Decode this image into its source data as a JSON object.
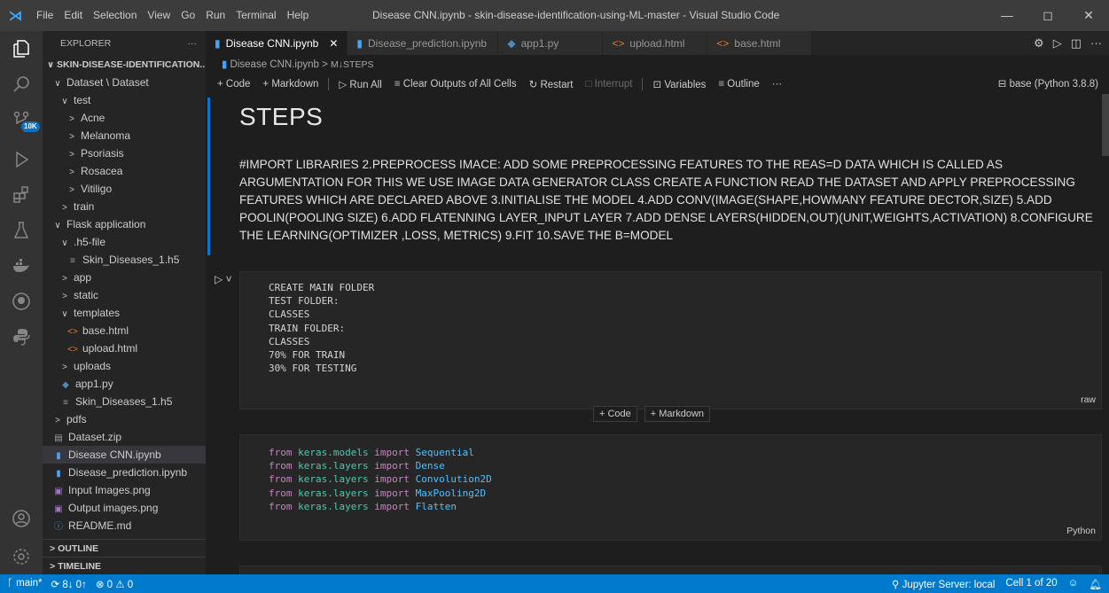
{
  "window": {
    "title": "Disease CNN.ipynb - skin-disease-identification-using-ML-master - Visual Studio Code",
    "menu": [
      "File",
      "Edit",
      "Selection",
      "View",
      "Go",
      "Run",
      "Terminal",
      "Help"
    ],
    "controls": {
      "minimize": "—",
      "maximize": "◻",
      "close": "✕"
    }
  },
  "activity": {
    "badge": "10K"
  },
  "explorer": {
    "header": "EXPLORER",
    "more": "···",
    "root": "SKIN-DISEASE-IDENTIFICATION...",
    "items": [
      {
        "label": "Dataset \\ Dataset",
        "chev": "∨",
        "depth": 1
      },
      {
        "label": "test",
        "chev": "∨",
        "depth": 2
      },
      {
        "label": "Acne",
        "chev": ">",
        "depth": 3
      },
      {
        "label": "Melanoma",
        "chev": ">",
        "depth": 3
      },
      {
        "label": "Psoriasis",
        "chev": ">",
        "depth": 3
      },
      {
        "label": "Rosacea",
        "chev": ">",
        "depth": 3
      },
      {
        "label": "Vitiligo",
        "chev": ">",
        "depth": 3
      },
      {
        "label": "train",
        "chev": ">",
        "depth": 2
      },
      {
        "label": "Flask application",
        "chev": "∨",
        "depth": 1
      },
      {
        "label": ".h5-file",
        "chev": "∨",
        "depth": 2
      },
      {
        "label": "Skin_Diseases_1.h5",
        "icon": "≡",
        "depth": 3
      },
      {
        "label": "app",
        "chev": ">",
        "depth": 2
      },
      {
        "label": "static",
        "chev": ">",
        "depth": 2
      },
      {
        "label": "templates",
        "chev": "∨",
        "depth": 2
      },
      {
        "label": "base.html",
        "icon": "<>",
        "depth": 3
      },
      {
        "label": "upload.html",
        "icon": "<>",
        "depth": 3
      },
      {
        "label": "uploads",
        "chev": ">",
        "depth": 2
      },
      {
        "label": "app1.py",
        "icon": "◆",
        "depth": 2
      },
      {
        "label": "Skin_Diseases_1.h5",
        "icon": "≡",
        "depth": 2
      },
      {
        "label": "pdfs",
        "chev": ">",
        "depth": 1
      },
      {
        "label": "Dataset.zip",
        "icon": "▤",
        "depth": 1
      },
      {
        "label": "Disease CNN.ipynb",
        "icon": "▮",
        "depth": 1,
        "selected": true
      },
      {
        "label": "Disease_prediction.ipynb",
        "icon": "▮",
        "depth": 1
      },
      {
        "label": "Input Images.png",
        "icon": "▣",
        "depth": 1
      },
      {
        "label": "Output images.png",
        "icon": "▣",
        "depth": 1
      },
      {
        "label": "README.md",
        "icon": "ⓘ",
        "depth": 1
      }
    ],
    "outline": "OUTLINE",
    "timeline": "TIMELINE"
  },
  "tabs": [
    {
      "label": "Disease CNN.ipynb",
      "active": true,
      "close": "✕"
    },
    {
      "label": "Disease_prediction.ipynb"
    },
    {
      "label": "app1.py"
    },
    {
      "label": "upload.html"
    },
    {
      "label": "base.html"
    }
  ],
  "breadcrumb": {
    "file": "Disease CNN.ipynb",
    "sep": ">",
    "section": "M↓STEPS"
  },
  "toolbar": {
    "code": "+ Code",
    "markdown": "+ Markdown",
    "run_all": "▷ Run All",
    "clear": "≡ Clear Outputs of All Cells",
    "restart": "↻ Restart",
    "interrupt": "□ Interrupt",
    "variables": "⊡ Variables",
    "outline": "≡ Outline",
    "more": "···",
    "kernel": "base (Python 3.8.8)"
  },
  "notebook": {
    "heading": "STEPS",
    "paragraph": "#IMPORT LIBRARIES 2.PREPROCESS IMACE: ADD SOME PREPROCESSING FEATURES TO THE REAS=D DATA WHICH IS CALLED AS ARGUMENTATION FOR THIS WE USE IMAGE DATA GENERATOR CLASS CREATE A FUNCTION READ THE DATASET AND APPLY PREPROCESSING FEATURES WHICH ARE DECLARED ABOVE 3.INITIALISE THE MODEL 4.ADD CONV(IMAGE(SHAPE,HOWMANY FEATURE DECTOR,SIZE) 5.ADD POOLIN(POOLING SIZE) 6.ADD FLATENNING LAYER_INPUT LAYER 7.ADD DENSE LAYERS(HIDDEN,OUT)(UNIT,WEIGHTS,ACTIVATION) 8.CONFIGURE THE LEARNING(OPTIMIZER ,LOSS, METRICS) 9.FIT 10.SAVE THE B=MODEL",
    "run_glyph": "▷ ˅",
    "raw_lines": [
      "CREATE MAIN FOLDER",
      "TEST FOLDER:",
      "CLASSES",
      "TRAIN FOLDER:",
      "CLASSES",
      "70% FOR TRAIN",
      "30% FOR TESTING"
    ],
    "raw_lang": "raw",
    "add_code": "+ Code",
    "add_markdown": "+ Markdown",
    "code_lines": [
      {
        "from": "from",
        "module": "keras.models",
        "import": "import",
        "name": "Sequential"
      },
      {
        "from": "from",
        "module": "keras.layers",
        "import": "import",
        "name": "Dense"
      },
      {
        "from": "from",
        "module": "keras.layers",
        "import": "import",
        "name": "Convolution2D"
      },
      {
        "from": "from",
        "module": "keras.layers",
        "import": "import",
        "name": "MaxPooling2D"
      },
      {
        "from": "from",
        "module": "keras.layers",
        "import": "import",
        "name": "Flatten"
      }
    ],
    "code_lang": "Python"
  },
  "status": {
    "branch": "main*",
    "sync": "⟳ 8↓ 0↑",
    "problems": "⊗ 0 ⚠ 0",
    "jupyter": "Jupyter Server: local",
    "cell": "Cell 1 of 20"
  },
  "colors": {
    "accent": "#007acc",
    "cell_bar": "#0078d4",
    "keyword": "#c586c0",
    "module": "#4ec9b0",
    "class": "#4fc1ff"
  }
}
